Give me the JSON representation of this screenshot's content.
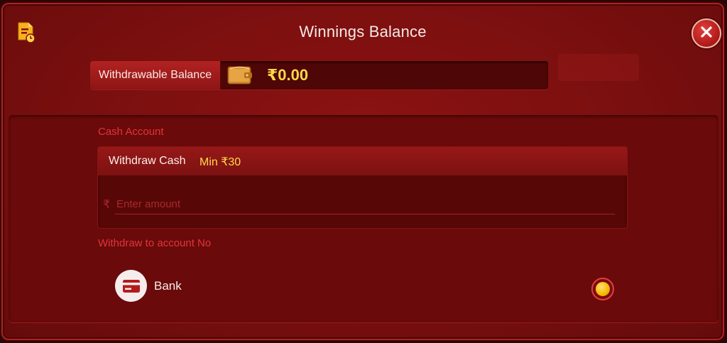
{
  "header": {
    "title": "Winnings Balance",
    "history_icon": "history-document-icon",
    "close_icon": "close-icon"
  },
  "balance": {
    "label": "Withdrawable Balance",
    "value": "₹0.00",
    "wallet_icon": "wallet-icon"
  },
  "cash_account": {
    "section_label": "Cash Account",
    "card_title": "Withdraw Cash",
    "min_label": "Min ₹30",
    "currency_symbol": "₹",
    "amount_placeholder": "Enter amount",
    "amount_value": ""
  },
  "withdraw_to": {
    "section_label": "Withdraw to account No",
    "option_label": "Bank",
    "option_icon": "bank-card-icon",
    "selected": true
  },
  "colors": {
    "background": "#7a0f0f",
    "accent_gold": "#ffd84a",
    "label_red": "#e0353a"
  }
}
